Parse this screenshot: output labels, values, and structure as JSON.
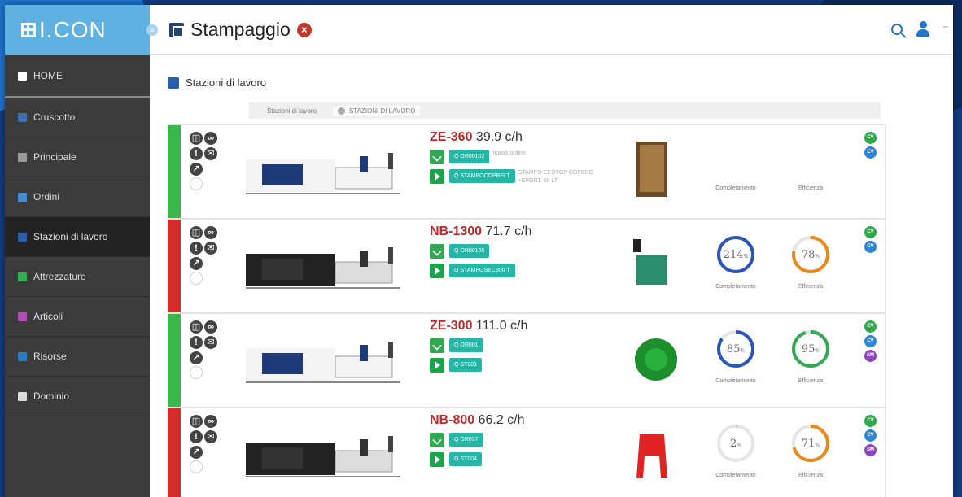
{
  "app": {
    "logo": "I.CON",
    "title": "Stampaggio"
  },
  "sidebar": {
    "items": [
      {
        "label": "HOME",
        "icon": "home-icon",
        "color": "#ffffff"
      },
      {
        "label": "Cruscotto",
        "icon": "dashboard-icon",
        "color": "#3d6fb5"
      },
      {
        "label": "Principale",
        "icon": "document-icon",
        "color": "#9a9a9a"
      },
      {
        "label": "Ordini",
        "icon": "table-icon",
        "color": "#3c8fd6"
      },
      {
        "label": "Stazioni di lavoro",
        "icon": "workstation-icon",
        "color": "#2a5fa8"
      },
      {
        "label": "Attrezzature",
        "icon": "tools-icon",
        "color": "#2db24f"
      },
      {
        "label": "Articoli",
        "icon": "article-icon",
        "color": "#b24fb5"
      },
      {
        "label": "Risorse",
        "icon": "share-icon",
        "color": "#2a7fc4"
      },
      {
        "label": "Dominio",
        "icon": "domain-icon",
        "color": "#dddddd"
      }
    ]
  },
  "content": {
    "section_title": "Stazioni di lavoro",
    "filter_label": "Stazioni di lavoro",
    "filter_chip": "STAZIONI DI LAVORO",
    "gauge_labels": {
      "completion": "Completamento",
      "efficiency": "Efficienza"
    }
  },
  "machines": [
    {
      "code": "ZE-360",
      "rate": "39.9 c/h",
      "status_color": "#3cb64a",
      "order_tag": "Q OR00102",
      "order_note": "nuovo ordine",
      "tool_tag": "Q STAMPOCOPBELT",
      "tool_note": "STAMPO ECOTOP COPERC +SPORT. 30 LT",
      "completion": null,
      "efficiency": null,
      "badges": [
        "CV",
        "CV"
      ]
    },
    {
      "code": "NB-1300",
      "rate": "71.7 c/h",
      "status_color": "#d62b2b",
      "order_tag": "Q OR00105",
      "order_note": "",
      "tool_tag": "Q STAMPOSEC800 T",
      "tool_note": "",
      "completion": "214",
      "efficiency": "78",
      "badges": [
        "CV",
        "CV"
      ]
    },
    {
      "code": "ZE-300",
      "rate": "111.0 c/h",
      "status_color": "#3cb64a",
      "order_tag": "Q OR001",
      "order_note": "",
      "tool_tag": "Q ST001",
      "tool_note": "",
      "completion": "85",
      "efficiency": "95",
      "badges": [
        "CV",
        "CV",
        "SM"
      ]
    },
    {
      "code": "NB-800",
      "rate": "66.2 c/h",
      "status_color": "#d62b2b",
      "order_tag": "Q OR037",
      "order_note": "",
      "tool_tag": "Q ST004",
      "tool_note": "",
      "completion": "2",
      "efficiency": "71",
      "badges": [
        "CV",
        "CV",
        "SM"
      ]
    }
  ],
  "colors": {
    "cv_green": "#2eaa4a",
    "cv_blue": "#2e86d2",
    "sm_purple": "#8a48b8",
    "gauge_blue": "#2b56b8",
    "gauge_orange": "#e88a1c",
    "gauge_green": "#34a853"
  }
}
